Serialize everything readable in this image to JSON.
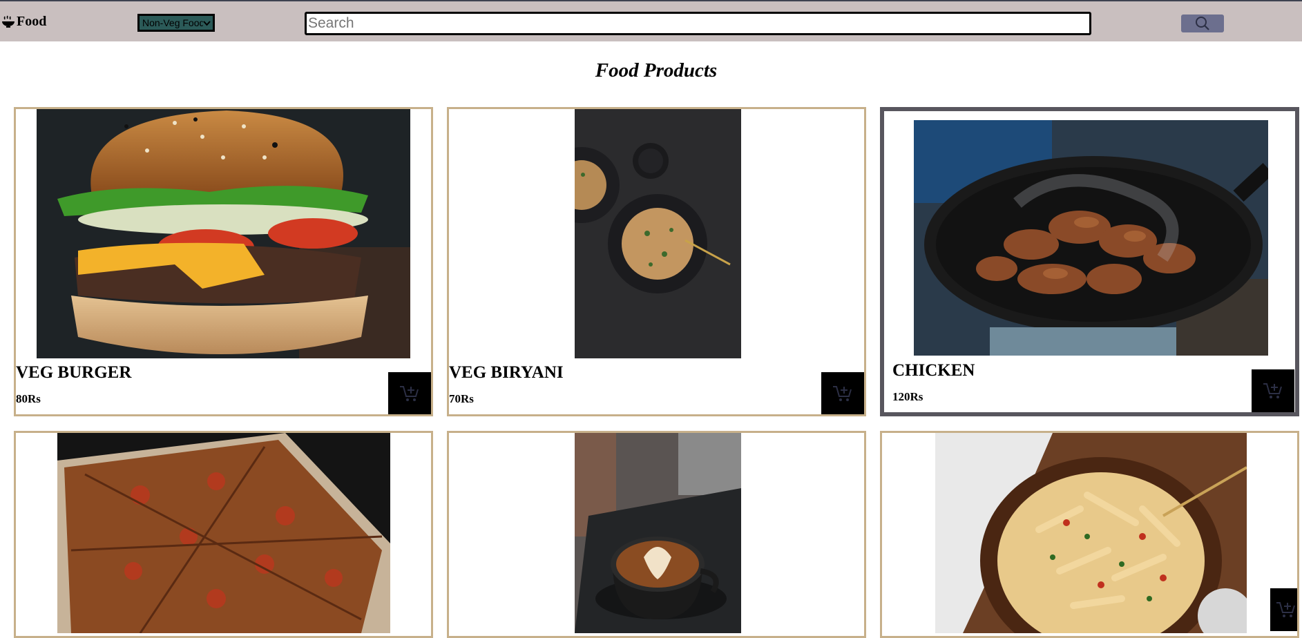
{
  "header": {
    "brand_label": "Food",
    "brand_icon": "bowl-icon",
    "filter_selected": "Non-Veg Food",
    "search_placeholder": "Search",
    "search_icon": "search-icon"
  },
  "main": {
    "heading": "Food Products",
    "products": [
      {
        "name": "VEG BURGER",
        "price": "80Rs",
        "image": "burger"
      },
      {
        "name": "VEG BIRYANI",
        "price": "70Rs",
        "image": "biryani"
      },
      {
        "name": "CHICKEN",
        "price": "120Rs",
        "image": "chicken"
      },
      {
        "name": "",
        "price": "",
        "image": "pizza"
      },
      {
        "name": "",
        "price": "",
        "image": "coffee"
      },
      {
        "name": "",
        "price": "",
        "image": "pasta"
      }
    ]
  },
  "colors": {
    "navbar": "#c9bfbf",
    "card_border": "#c7b08a",
    "active_card_border": "#58565e",
    "search_button": "#6c6f8e",
    "cart_button": "#000000"
  }
}
